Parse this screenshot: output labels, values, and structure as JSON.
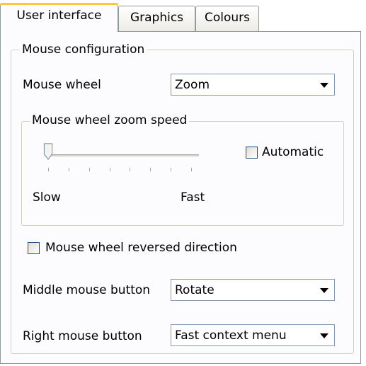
{
  "tabs": [
    {
      "label": "User interface",
      "active": true
    },
    {
      "label": "Graphics",
      "active": false
    },
    {
      "label": "Colours",
      "active": false
    }
  ],
  "mouse_config": {
    "title": "Mouse configuration",
    "mouse_wheel_label": "Mouse wheel",
    "mouse_wheel_value": "Zoom",
    "zoom_speed": {
      "title": "Mouse wheel zoom speed",
      "slow_label": "Slow",
      "fast_label": "Fast",
      "automatic_label": "Automatic",
      "automatic_checked": false,
      "slider_level": 0,
      "tick_count": 8
    },
    "reversed_label": "Mouse wheel reversed direction",
    "reversed_checked": false,
    "middle_label": "Middle mouse button",
    "middle_value": "Rotate",
    "right_label": "Right mouse button",
    "right_value": "Fast context menu"
  },
  "colors": {
    "tab_highlight": "#ffc83c",
    "border": "#919b9c",
    "input_border": "#7f9db9",
    "checkbox_border": "#1c5180"
  }
}
